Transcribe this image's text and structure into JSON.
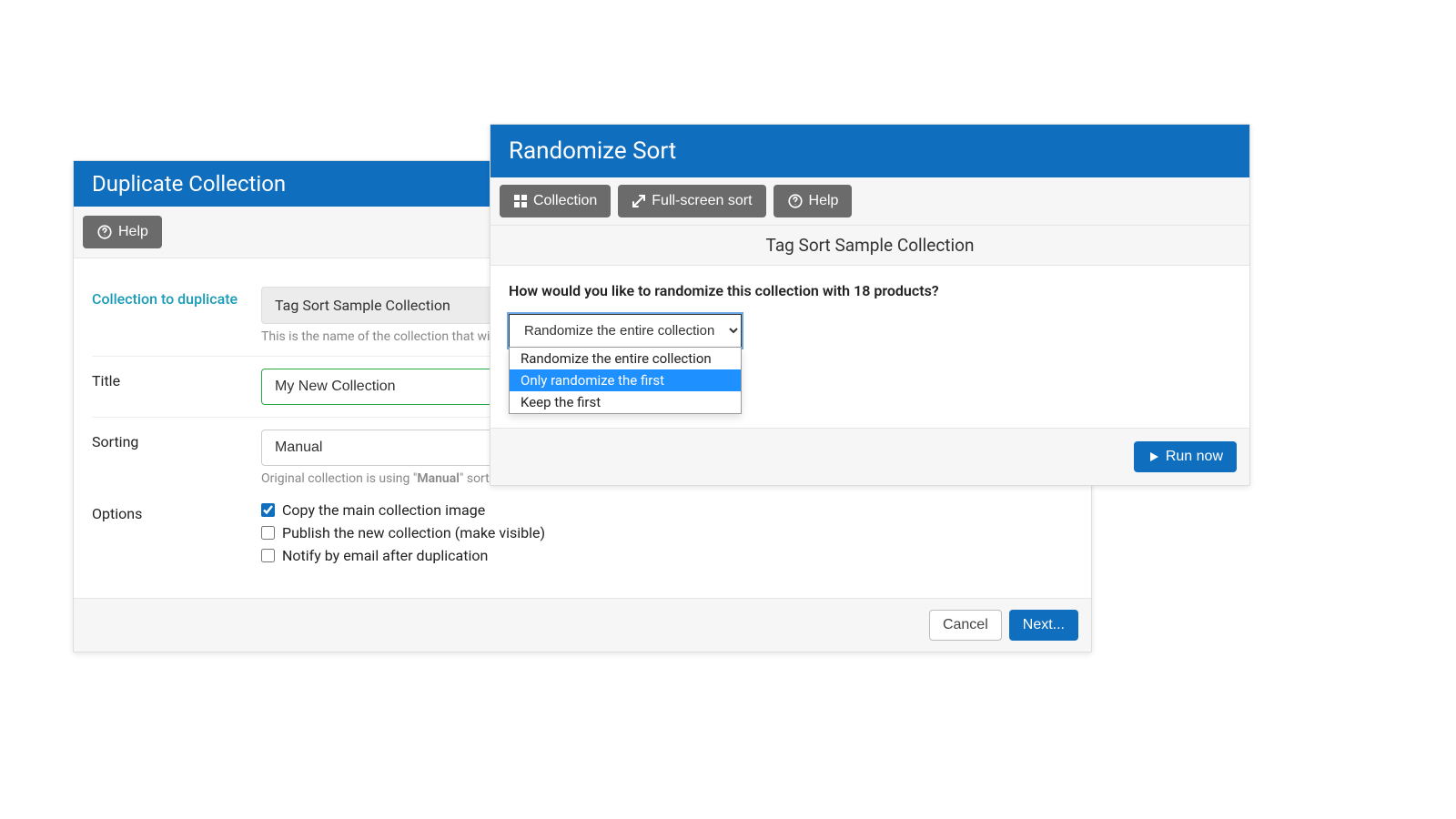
{
  "left_panel": {
    "title": "Duplicate Collection",
    "help_label": "Help",
    "rows": {
      "collection_label": "Collection to duplicate",
      "collection_value": "Tag Sort Sample Collection",
      "collection_help": "This is the name of the collection that will ",
      "title_label": "Title",
      "title_value": "My New Collection",
      "sorting_label": "Sorting",
      "sorting_value": "Manual",
      "sorting_help_prefix": "Original collection is using \"",
      "sorting_help_bold": "Manual",
      "sorting_help_suffix": "\" sorting.",
      "options_label": "Options",
      "opt_copy_image": "Copy the main collection image",
      "opt_publish": "Publish the new collection (make visible)",
      "opt_notify": "Notify by email after duplication"
    },
    "footer": {
      "cancel_label": "Cancel",
      "next_label": "Next..."
    }
  },
  "right_panel": {
    "title": "Randomize Sort",
    "toolbar": {
      "collection_label": "Collection",
      "fullscreen_label": "Full-screen sort",
      "help_label": "Help"
    },
    "subheader": "Tag Sort Sample Collection",
    "prompt": "How would you like to randomize this collection with 18 products?",
    "select_value": "Randomize the entire collection",
    "dropdown": {
      "opt0": "Randomize the entire collection",
      "opt1": "Only randomize the first",
      "opt2": "Keep the first"
    },
    "run_label": "Run now"
  }
}
